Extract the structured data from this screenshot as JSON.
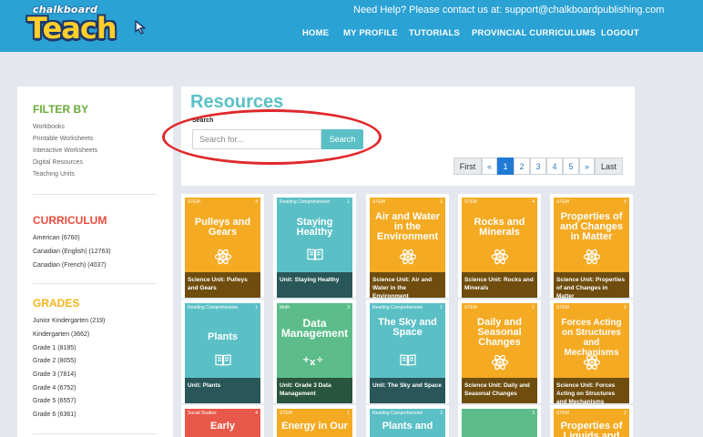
{
  "colors": {
    "header": "#2ba2d4",
    "accent": "#5bc0c6",
    "stem": "#f4aa22",
    "reading": "#5bc0c6",
    "math": "#5cbd8a",
    "social": "#e8584a"
  },
  "header": {
    "logo_small": "chalkboard",
    "logo_big": "Teach",
    "help_text": "Need Help? Please contact us at:  support@chalkboardpublishing.com",
    "nav": [
      "HOME",
      "MY PROFILE",
      "TUTORIALS",
      "PROVINCIAL CURRICULUMS",
      "LOGOUT"
    ]
  },
  "sidebar": {
    "filter_heading": "FILTER BY",
    "filter_items": [
      "Workbooks",
      "Printable Worksheets",
      "Interactive Worksheets",
      "Digital Resources",
      "Teaching Units"
    ],
    "curriculum_heading": "CURRICULUM",
    "curriculum_items": [
      "American (6760)",
      "Canadian (English) (12763)",
      "Canadian (French) (4037)"
    ],
    "grades_heading": "GRADES",
    "grades_items": [
      "Junior Kindergarten (219)",
      "Kindergarten (3662)",
      "Grade 1 (8185)",
      "Grade 2 (8055)",
      "Grade 3 (7814)",
      "Grade 4 (6752)",
      "Grade 5 (6557)",
      "Grade 6 (6361)"
    ]
  },
  "main": {
    "title": "Resources",
    "search_label": "Search",
    "search_placeholder": "Search for...",
    "search_button": "Search",
    "pagination": [
      "First",
      "«",
      "1",
      "2",
      "3",
      "4",
      "5",
      "»",
      "Last"
    ],
    "active_page": "1"
  },
  "cards": [
    {
      "tag": "STEM",
      "num": "4",
      "title": "Pulleys and Gears",
      "icon": "atom-icon",
      "footer": "Science Unit: Pulleys and Gears",
      "color": "#f4aa22"
    },
    {
      "tag": "Reading Comprehension",
      "num": "1",
      "title": "Staying Healthy",
      "icon": "book-icon",
      "footer": "Unit: Staying Healthy",
      "color": "#5bc0c6"
    },
    {
      "tag": "STEM",
      "num": "2",
      "title": "Air and Water in the Environment",
      "icon": "atom-icon",
      "footer": "Science Unit: Air and Water in the Environment",
      "color": "#f4aa22"
    },
    {
      "tag": "STEM",
      "num": "4",
      "title": "Rocks and Minerals",
      "icon": "atom-icon",
      "footer": "Science Unit: Rocks and Minerals",
      "color": "#f4aa22"
    },
    {
      "tag": "STEM",
      "num": "5",
      "title": "Properties of and Changes in Matter",
      "icon": "atom-icon",
      "footer": "Science Unit: Properties of and Changes in Matter",
      "color": "#f4aa22"
    },
    {
      "tag": "Reading Comprehension",
      "num": "1",
      "title": "Plants",
      "icon": "book-icon",
      "footer": "Unit: Plants",
      "color": "#5bc0c6"
    },
    {
      "tag": "Math",
      "num": "3",
      "title": "Data Management",
      "icon": "math-icon",
      "footer": "Unit: Grade 3 Data Management",
      "color": "#5cbd8a"
    },
    {
      "tag": "Reading Comprehension",
      "num": "1",
      "title": "The Sky and Space",
      "icon": "book-icon",
      "footer": "Unit: The Sky and Space",
      "color": "#5bc0c6"
    },
    {
      "tag": "STEM",
      "num": "1",
      "title": "Daily and Seasonal Changes",
      "icon": "atom-icon",
      "footer": "Science Unit: Daily and Seasonal Changes",
      "color": "#f4aa22"
    },
    {
      "tag": "STEM",
      "num": "5",
      "title": "Forces Acting on Structures and Mechanisms",
      "icon": "atom-icon",
      "footer": "Science Unit: Forces Acting on Structures and Mechanisms",
      "color": "#f4aa22"
    },
    {
      "tag": "Social Studies",
      "num": "4",
      "title": "Early",
      "icon": "",
      "footer": "",
      "color": "#e8584a"
    },
    {
      "tag": "STEM",
      "num": "1",
      "title": "Energy in Our",
      "icon": "",
      "footer": "",
      "color": "#f4aa22"
    },
    {
      "tag": "Reading Comprehension",
      "num": "2",
      "title": "Plants and",
      "icon": "",
      "footer": "",
      "color": "#5bc0c6"
    },
    {
      "tag": "",
      "num": "3",
      "title": "",
      "icon": "",
      "footer": "",
      "color": "#5cbd8a"
    },
    {
      "tag": "STEM",
      "num": "2",
      "title": "Properties of Liquids and",
      "icon": "",
      "footer": "",
      "color": "#f4aa22"
    }
  ]
}
